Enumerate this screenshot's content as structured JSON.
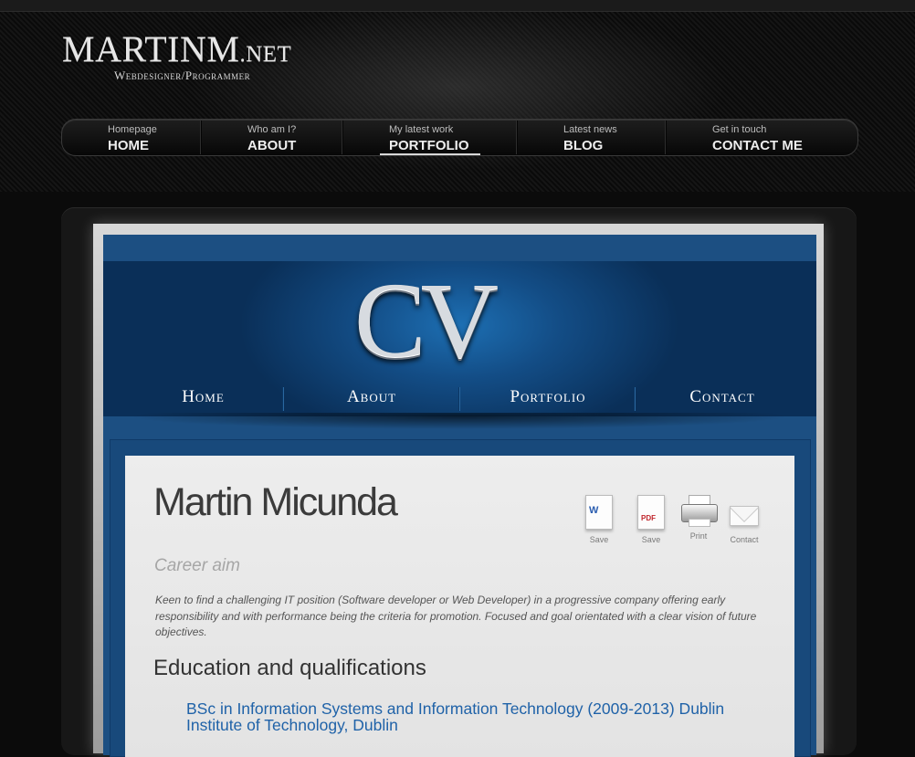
{
  "logo": {
    "main": "MARTINM",
    "suffix": ".NET",
    "tagline": "Webdesigner/Programmer"
  },
  "topnav": [
    {
      "small": "Homepage",
      "label": "HOME"
    },
    {
      "small": "Who am I?",
      "label": "ABOUT"
    },
    {
      "small": "My latest work",
      "label": "PORTFOLIO",
      "active": true
    },
    {
      "small": "Latest news",
      "label": "BLOG"
    },
    {
      "small": "Get in touch",
      "label": "CONTACT ME"
    }
  ],
  "cv": {
    "logo_text": "CV",
    "nav": [
      "Home",
      "About",
      "Portfolio",
      "Contact"
    ],
    "name": "Martin Micunda",
    "actions": [
      {
        "icon": "word-document-icon",
        "label": "Save"
      },
      {
        "icon": "pdf-document-icon",
        "label": "Save"
      },
      {
        "icon": "printer-icon",
        "label": "Print"
      },
      {
        "icon": "envelope-icon",
        "label": "Contact"
      }
    ],
    "career_aim_heading": "Career aim",
    "career_aim_text": "Keen to find a challenging IT position (Software developer or Web Developer) in a progressive company offering early responsibility and with performance being the criteria for promotion. Focused and goal orientated with a clear vision of future objectives.",
    "education_heading": "Education and qualifications",
    "education_items": [
      "BSc in Information Systems and Information Technology (2009-2013) Dublin Institute of Technology, Dublin"
    ]
  },
  "colors": {
    "page_bg": "#0b0b0b",
    "cv_blue": "#1c4f82",
    "link_blue": "#1f62a8"
  }
}
